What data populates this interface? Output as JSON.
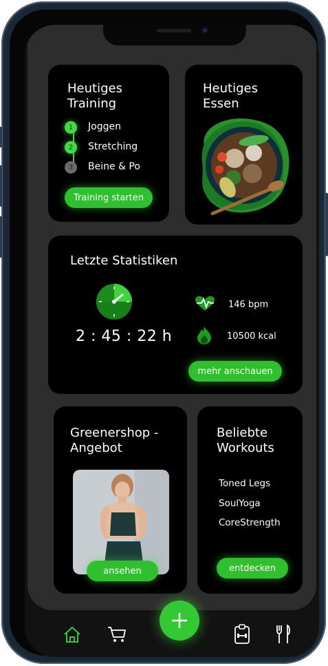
{
  "colors": {
    "accent": "#2fbf2f",
    "card": "#000000",
    "background": "#2d2d2d",
    "muted_step": "#6b6b6b"
  },
  "training": {
    "title": "Heutiges\nTraining",
    "steps": [
      {
        "number": "1",
        "label": "Joggen",
        "done": true
      },
      {
        "number": "2",
        "label": "Stretching",
        "done": true
      },
      {
        "number": "3",
        "label": "Beine & Po",
        "done": false
      }
    ],
    "button": "Training starten"
  },
  "food": {
    "title": "Heutiges\nEssen",
    "image_icon": "food-bowl-image"
  },
  "stats": {
    "title": "Letzte Statistiken",
    "time": "2 : 45 : 22 h",
    "heart_rate": "146 bpm",
    "calories": "10500 kcal",
    "button": "mehr anschauen"
  },
  "shop": {
    "title": "Greenershop -\nAngebot",
    "button": "ansehen",
    "image_icon": "athlete-photo"
  },
  "workouts": {
    "title": "Beliebte\nWorkouts",
    "items": [
      "Toned Legs",
      "SoulYoga",
      "CoreStrength"
    ],
    "button": "entdecken"
  },
  "nav": {
    "items": [
      {
        "icon": "home-icon",
        "active": true
      },
      {
        "icon": "cart-icon",
        "active": false
      },
      {
        "icon": "plus-icon",
        "active": false
      },
      {
        "icon": "clipboard-icon",
        "active": false
      },
      {
        "icon": "fork-knife-icon",
        "active": false
      }
    ]
  }
}
